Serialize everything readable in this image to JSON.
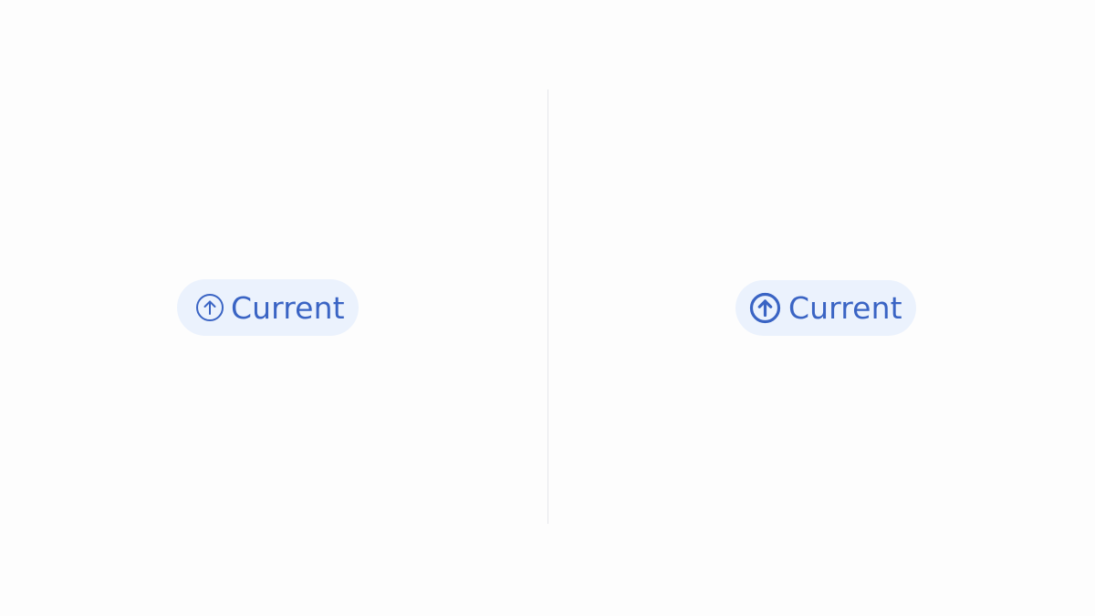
{
  "colors": {
    "badge_background": "#ebf2fd",
    "badge_foreground": "#3a64c4",
    "divider": "#e4e6ea",
    "page_background": "#fdfdfd"
  },
  "badges": [
    {
      "label": "Current",
      "icon": "arrow-up-circle-icon",
      "variant": "regular-stroke"
    },
    {
      "label": "Current",
      "icon": "arrow-up-circle-icon",
      "variant": "bold-stroke"
    }
  ]
}
